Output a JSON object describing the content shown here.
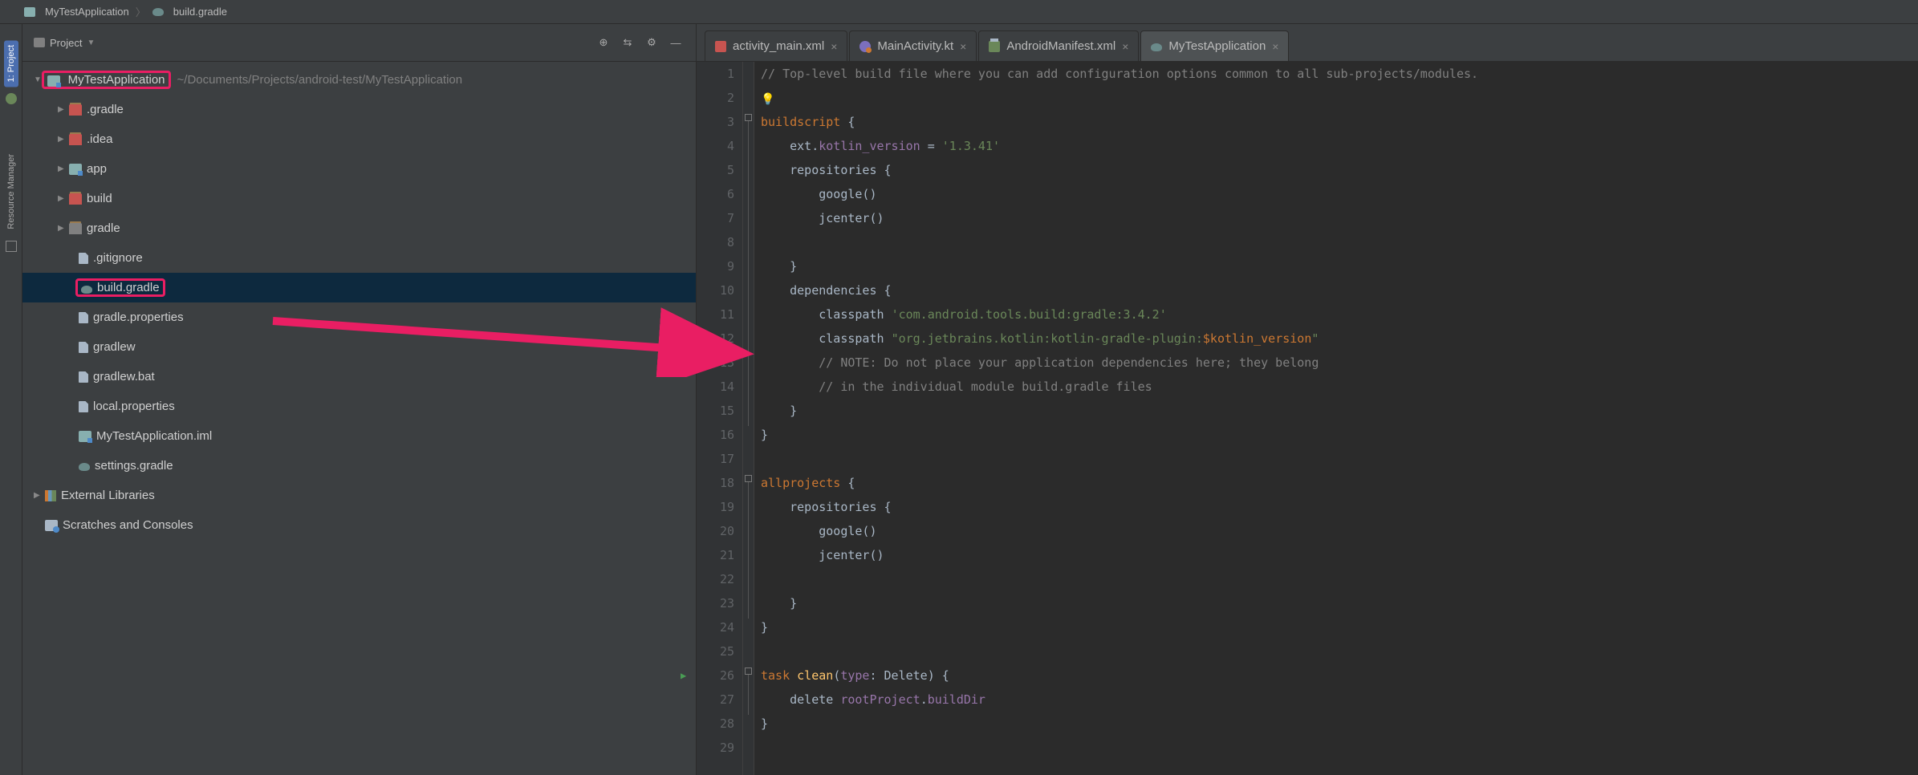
{
  "breadcrumb": {
    "root": "MyTestApplication",
    "file": "build.gradle"
  },
  "rail": {
    "project": "1: Project",
    "resmgr": "Resource Manager"
  },
  "sidebar": {
    "header": "Project",
    "root": {
      "name": "MyTestApplication",
      "path": "~/Documents/Projects/android-test/MyTestApplication"
    },
    "folders": {
      "gradle_dot": ".gradle",
      "idea": ".idea",
      "app": "app",
      "build": "build",
      "gradle_dir": "gradle"
    },
    "files": {
      "gitignore": ".gitignore",
      "buildgradle": "build.gradle",
      "gradleprops": "gradle.properties",
      "gradlew": "gradlew",
      "gradlewbat": "gradlew.bat",
      "localprops": "local.properties",
      "iml": "MyTestApplication.iml",
      "settings": "settings.gradle"
    },
    "extlib": "External Libraries",
    "scratches": "Scratches and Consoles"
  },
  "tabs": {
    "t1": "activity_main.xml",
    "t2": "MainActivity.kt",
    "t3": "AndroidManifest.xml",
    "t4": "MyTestApplication"
  },
  "code": {
    "l1": "// Top-level build file where you can add configuration options common to all sub-projects/modules.",
    "l3a": "buildscript",
    "l3b": " {",
    "l4a": "    ext.",
    "l4b": "kotlin_version",
    "l4c": " = ",
    "l4d": "'1.3.41'",
    "l5a": "    repositories ",
    "l5b": "{",
    "l6": "        google()",
    "l7": "        jcenter()",
    "l9": "    }",
    "l10a": "    dependencies ",
    "l10b": "{",
    "l11a": "        classpath ",
    "l11b": "'com.android.tools.build:gradle:3.4.2'",
    "l12a": "        classpath ",
    "l12b": "\"org.jetbrains.kotlin:kotlin-gradle-plugin:",
    "l12c": "$kotlin_version",
    "l12d": "\"",
    "l13": "        // NOTE: Do not place your application dependencies here; they belong",
    "l14": "        // in the individual module build.gradle files",
    "l15": "    }",
    "l16": "}",
    "l18a": "allprojects",
    "l18b": " {",
    "l19a": "    repositories ",
    "l19b": "{",
    "l20": "        google()",
    "l21": "        jcenter()",
    "l23": "    }",
    "l24": "}",
    "l26a": "task ",
    "l26b": "clean",
    "l26c": "(",
    "l26d": "type",
    "l26e": ": Delete) {",
    "l27a": "    delete ",
    "l27b": "rootProject",
    "l27c": ".",
    "l27d": "buildDir",
    "l28": "}"
  },
  "lines": [
    "1",
    "2",
    "3",
    "4",
    "5",
    "6",
    "7",
    "8",
    "9",
    "10",
    "11",
    "12",
    "13",
    "14",
    "15",
    "16",
    "17",
    "18",
    "19",
    "20",
    "21",
    "22",
    "23",
    "24",
    "25",
    "26",
    "27",
    "28",
    "29"
  ]
}
